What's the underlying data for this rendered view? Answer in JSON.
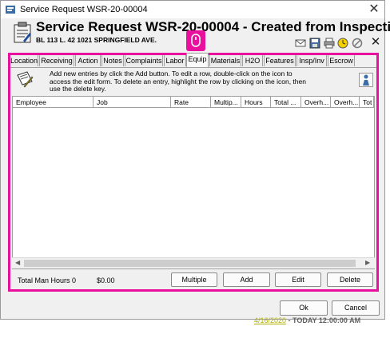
{
  "window": {
    "title": "Service Request WSR-20-00004",
    "close_glyph": "✕"
  },
  "header": {
    "title": "Service Request WSR-20-00004 - Created from Inspection",
    "subtitle": "BL 113 L. 42  1021 SPRINGFIELD AVE.",
    "toolbar_icons": [
      "mail-icon",
      "save-icon",
      "print-icon",
      "clock-icon",
      "ban-icon"
    ]
  },
  "tabs": [
    {
      "label": "Location"
    },
    {
      "label": "Receiving"
    },
    {
      "label": "Action"
    },
    {
      "label": "Notes"
    },
    {
      "label": "Complaints"
    },
    {
      "label": "Labor"
    },
    {
      "label": "Equip"
    },
    {
      "label": "Materials"
    },
    {
      "label": "H2O"
    },
    {
      "label": "Features"
    },
    {
      "label": "Insp/Inv"
    },
    {
      "label": "Escrow"
    }
  ],
  "selected_tab": "Equip",
  "panel": {
    "info_text": "Add new entries by click the Add button.  To edit a row, double-click on the icon to access the edit form.  To delete an entry, highlight the row by clicking on the icon, then use the delete key.",
    "columns": [
      "Employee",
      "Job",
      "Rate",
      "Multip...",
      "Hours",
      "Total ...",
      "Overh...",
      "Overh...",
      "Tot"
    ]
  },
  "footer": {
    "total_man_hours": "Total Man Hours 0",
    "total_amount": "$0.00",
    "buttons": {
      "multiple": "Multiple",
      "add": "Add",
      "edit": "Edit",
      "delete": "Delete"
    }
  },
  "dialog_buttons": {
    "ok": "Ok",
    "cancel": "Cancel"
  },
  "background_status": {
    "date": "4/16/2020",
    "rest": " - TODAY 12:00:00 AM"
  },
  "colors": {
    "highlight": "#e8109c",
    "status_date": "#b0b000"
  }
}
